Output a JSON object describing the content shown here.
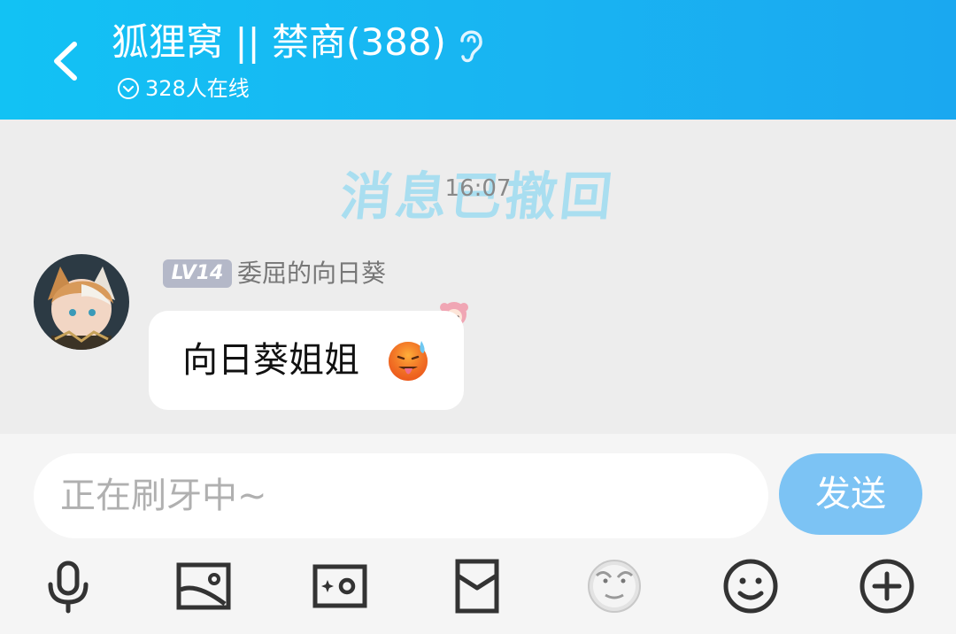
{
  "header": {
    "title": "狐狸窝 || 禁商(388)",
    "online": "328人在线",
    "background": "#19b4f2"
  },
  "chat": {
    "recall_banner": "消息已撤回",
    "time": "16:07",
    "message": {
      "level": "LV14",
      "nickname": "委屈的向日葵",
      "text": "向日葵姐姐",
      "emoji": "hot-face-emoji"
    }
  },
  "input": {
    "placeholder": "正在刷牙中~",
    "send_label": "发送",
    "send_color": "#7cc3f4"
  },
  "toolbar": [
    "microphone-icon",
    "image-icon",
    "camera-icon",
    "red-packet-icon",
    "sticker-face-icon",
    "emoji-icon",
    "plus-icon"
  ]
}
